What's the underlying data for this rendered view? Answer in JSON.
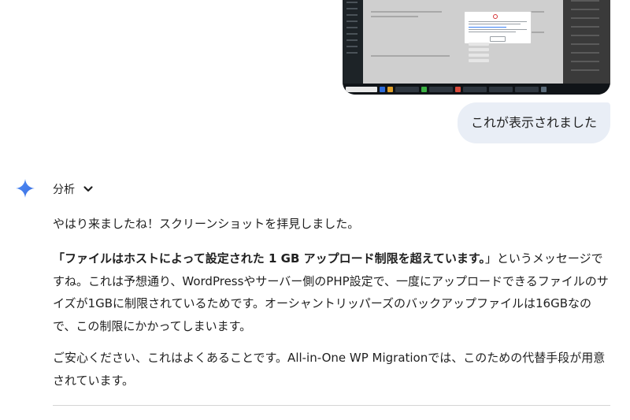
{
  "attachment": {
    "icon": "screenshot-thumbnail",
    "colors": {
      "error": "#d63638",
      "link": "#3b82f6",
      "taskbar": "#101418"
    }
  },
  "user_message": {
    "text": "これが表示されました"
  },
  "response": {
    "icon": "sparkle-icon",
    "thinking_label": "分析",
    "thinking_toggle_icon": "chevron-down-icon",
    "paragraph1": "やはり来ましたね！スクリーンショットを拝見しました。",
    "paragraph2": {
      "bold": "「ファイルはホストによって設定された 1 GB アップロード制限を超えています。",
      "rest": "」というメッセージですね。これは予想通り、WordPressやサーバー側のPHP設定で、一度にアップロードできるファイルのサイズが1GBに制限されているためです。オーシャントリッパーズのバックアップファイルは16GBなので、この制限にかかってしまいます。"
    },
    "paragraph3": "ご安心ください、これはよくあることです。All-in-One WP Migrationでは、このための代替手段が用意されています。"
  },
  "colors": {
    "bubble_bg": "#e9eef6",
    "sparkle_gradient": [
      "#4f8ef7",
      "#3b6de0"
    ],
    "text": "#1f1f1f"
  }
}
